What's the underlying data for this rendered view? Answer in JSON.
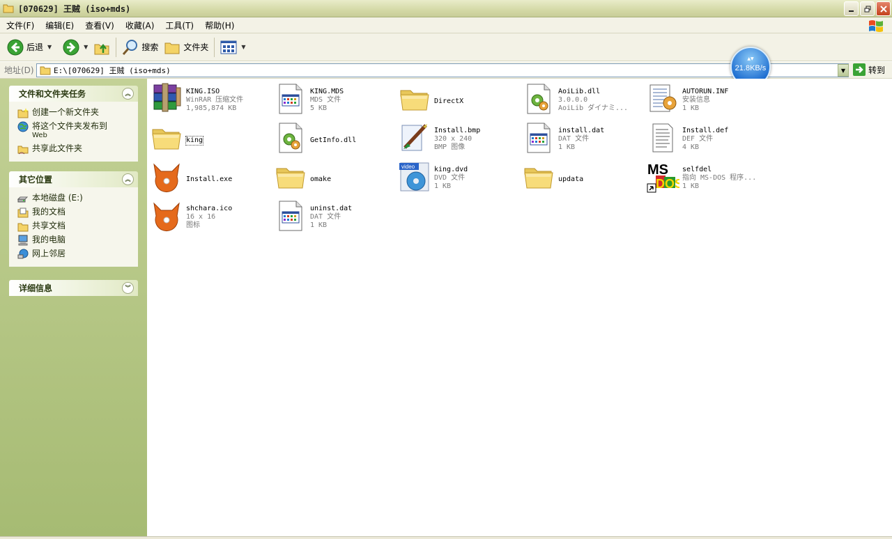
{
  "window": {
    "title": "[070629] 王贼 (iso+mds)"
  },
  "menu": [
    "文件(F)",
    "编辑(E)",
    "查看(V)",
    "收藏(A)",
    "工具(T)",
    "帮助(H)"
  ],
  "toolbar": {
    "back_label": "后退",
    "search_label": "搜索",
    "folders_label": "文件夹"
  },
  "address": {
    "label": "地址(D)",
    "path": "E:\\[070629] 王贼 (iso+mds)",
    "go_label": "转到"
  },
  "speed": {
    "value": "21.8KB/s"
  },
  "taskpane": {
    "file_tasks": {
      "title": "文件和文件夹任务",
      "items": [
        {
          "label": "创建一个新文件夹",
          "sub": ""
        },
        {
          "label": "将这个文件夹发布到",
          "sub": "Web"
        },
        {
          "label": "共享此文件夹",
          "sub": ""
        }
      ]
    },
    "other_places": {
      "title": "其它位置",
      "items": [
        "本地磁盘 (E:)",
        "我的文档",
        "共享文档",
        "我的电脑",
        "网上邻居"
      ]
    },
    "details": {
      "title": "详细信息"
    }
  },
  "files": [
    {
      "name": "KING.ISO",
      "line2": "WinRAR 压缩文件",
      "line3": "1,985,874 KB",
      "icon": "winrar-icon"
    },
    {
      "name": "KING.MDS",
      "line2": "MDS 文件",
      "line3": "5 KB",
      "icon": "generic-window-file-icon"
    },
    {
      "name": "DirectX",
      "line2": "",
      "line3": "",
      "icon": "folder-icon"
    },
    {
      "name": "AoiLib.dll",
      "line2": "3.0.0.0",
      "line3": "AoiLib ダイナミ...",
      "icon": "dll-icon"
    },
    {
      "name": "AUTORUN.INF",
      "line2": "安装信息",
      "line3": "1 KB",
      "icon": "inf-icon"
    },
    {
      "name": "king",
      "line2": "",
      "line3": "",
      "icon": "folder-icon"
    },
    {
      "name": "GetInfo.dll",
      "line2": "",
      "line3": "",
      "icon": "dll-icon"
    },
    {
      "name": "Install.bmp",
      "line2": "320 x 240",
      "line3": "BMP 图像",
      "icon": "paint-bmp-icon"
    },
    {
      "name": "install.dat",
      "line2": "DAT 文件",
      "line3": "1 KB",
      "icon": "generic-window-file-icon"
    },
    {
      "name": "Install.def",
      "line2": "DEF 文件",
      "line3": "4 KB",
      "icon": "text-document-icon"
    },
    {
      "name": "Install.exe",
      "line2": "",
      "line3": "",
      "icon": "fox-cd-icon"
    },
    {
      "name": "omake",
      "line2": "",
      "line3": "",
      "icon": "folder-icon"
    },
    {
      "name": "king.dvd",
      "line2": "DVD 文件",
      "line3": "1 KB",
      "icon": "video-dvd-icon"
    },
    {
      "name": "updata",
      "line2": "",
      "line3": "",
      "icon": "folder-icon"
    },
    {
      "name": "selfdel",
      "line2": "指向 MS-DOS 程序...",
      "line3": "1 KB",
      "icon": "msdos-shortcut-icon"
    },
    {
      "name": "shchara.ico",
      "line2": "16 x 16",
      "line3": "图标",
      "icon": "fox-icon"
    },
    {
      "name": "uninst.dat",
      "line2": "DAT 文件",
      "line3": "1 KB",
      "icon": "generic-window-file-icon"
    }
  ]
}
